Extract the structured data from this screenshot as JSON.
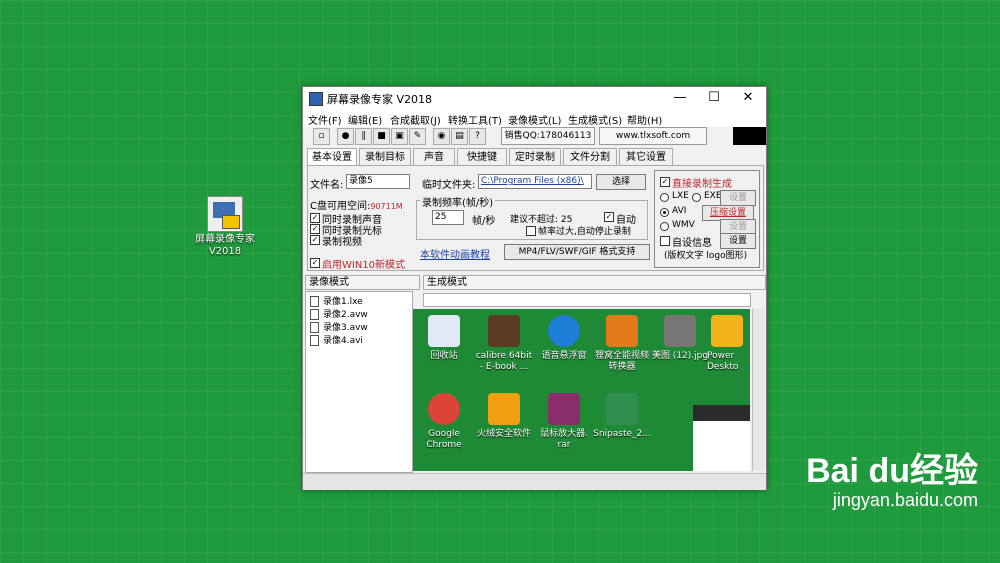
{
  "desktop_icon": {
    "label_line1": "屏幕录像专家",
    "label_line2": "V2018"
  },
  "window": {
    "title": "屏幕录像专家 V2018",
    "controls": {
      "minimize": "—",
      "maximize": "☐",
      "close": "✕"
    },
    "menu": [
      "文件(F)",
      "编辑(E)",
      "合成截取(J)",
      "转换工具(T)",
      "录像模式(L)",
      "生成模式(S)",
      "帮助(H)"
    ],
    "toolbar": {
      "qq_label": "销售QQ:178046113",
      "site_label": "www.tlxsoft.com"
    },
    "tabs": [
      "基本设置",
      "录制目标",
      "声音",
      "快捷键",
      "定时录制",
      "文件分割",
      "其它设置"
    ],
    "basic": {
      "filename_label": "文件名:",
      "filename_value": "录像5",
      "temp_folder_label": "临时文件夹:",
      "temp_folder_value": "C:\\Program Files (x86)\\",
      "choose_button": "选择",
      "disk_space_label": "C盘可用空间:",
      "disk_space_value": "90711M",
      "rec_sound": "同时录制声音",
      "rec_cursor": "同时录制光标",
      "rec_video": "录制视频",
      "win10_mode": "启用WIN10新模式",
      "fps_group_label": "录制频率(帧/秒)",
      "fps_value": "25",
      "fps_unit": "帧/秒",
      "fps_suggest": "建议不超过: 25",
      "fps_auto": "自动",
      "fps_auto_stop": "帧率过大,自动停止录制",
      "tutorial_link": "本软件动画教程",
      "format_button": "MP4/FLV/SWF/GIF  格式支持",
      "direct_gen": "直接录制生成",
      "fmt_lxe": "LXE",
      "fmt_exe": "EXE",
      "fmt_avi": "AVI",
      "fmt_wmv": "WMV",
      "settings_btn": "设置",
      "compress_btn": "压缩设置",
      "settings_btn2": "设置",
      "custom_info": "自设信息",
      "custom_info_note": "(版权文字 logo图形)",
      "settings_btn3": "设置"
    },
    "rec_mode_header": "录像模式",
    "gen_mode_header": "生成模式",
    "files": [
      "录像1.lxe",
      "录像2.avw",
      "录像3.avw",
      "录像4.avi"
    ],
    "preview_icons": [
      {
        "line1": "回收站",
        "line2": ""
      },
      {
        "line1": "calibre 64bit",
        "line2": "- E-book ..."
      },
      {
        "line1": "语音悬浮窗",
        "line2": ""
      },
      {
        "line1": "狸窝全能视频",
        "line2": "转换器"
      },
      {
        "line1": "美图 (12).jpg",
        "line2": ""
      },
      {
        "line1": "Power",
        "line2": "Deskto"
      },
      {
        "line1": "Google",
        "line2": "Chrome"
      },
      {
        "line1": "火绒安全软件",
        "line2": ""
      },
      {
        "line1": "鼠标放大器.",
        "line2": "rar"
      },
      {
        "line1": "Snipaste_2...",
        "line2": ""
      }
    ]
  },
  "watermark": {
    "brand": "Bai du经验",
    "url": "jingyan.baidu.com"
  },
  "colors": {
    "desktop": "#1f9a3c",
    "accent_red": "#c0262a",
    "link_blue": "#1a3fa0"
  }
}
